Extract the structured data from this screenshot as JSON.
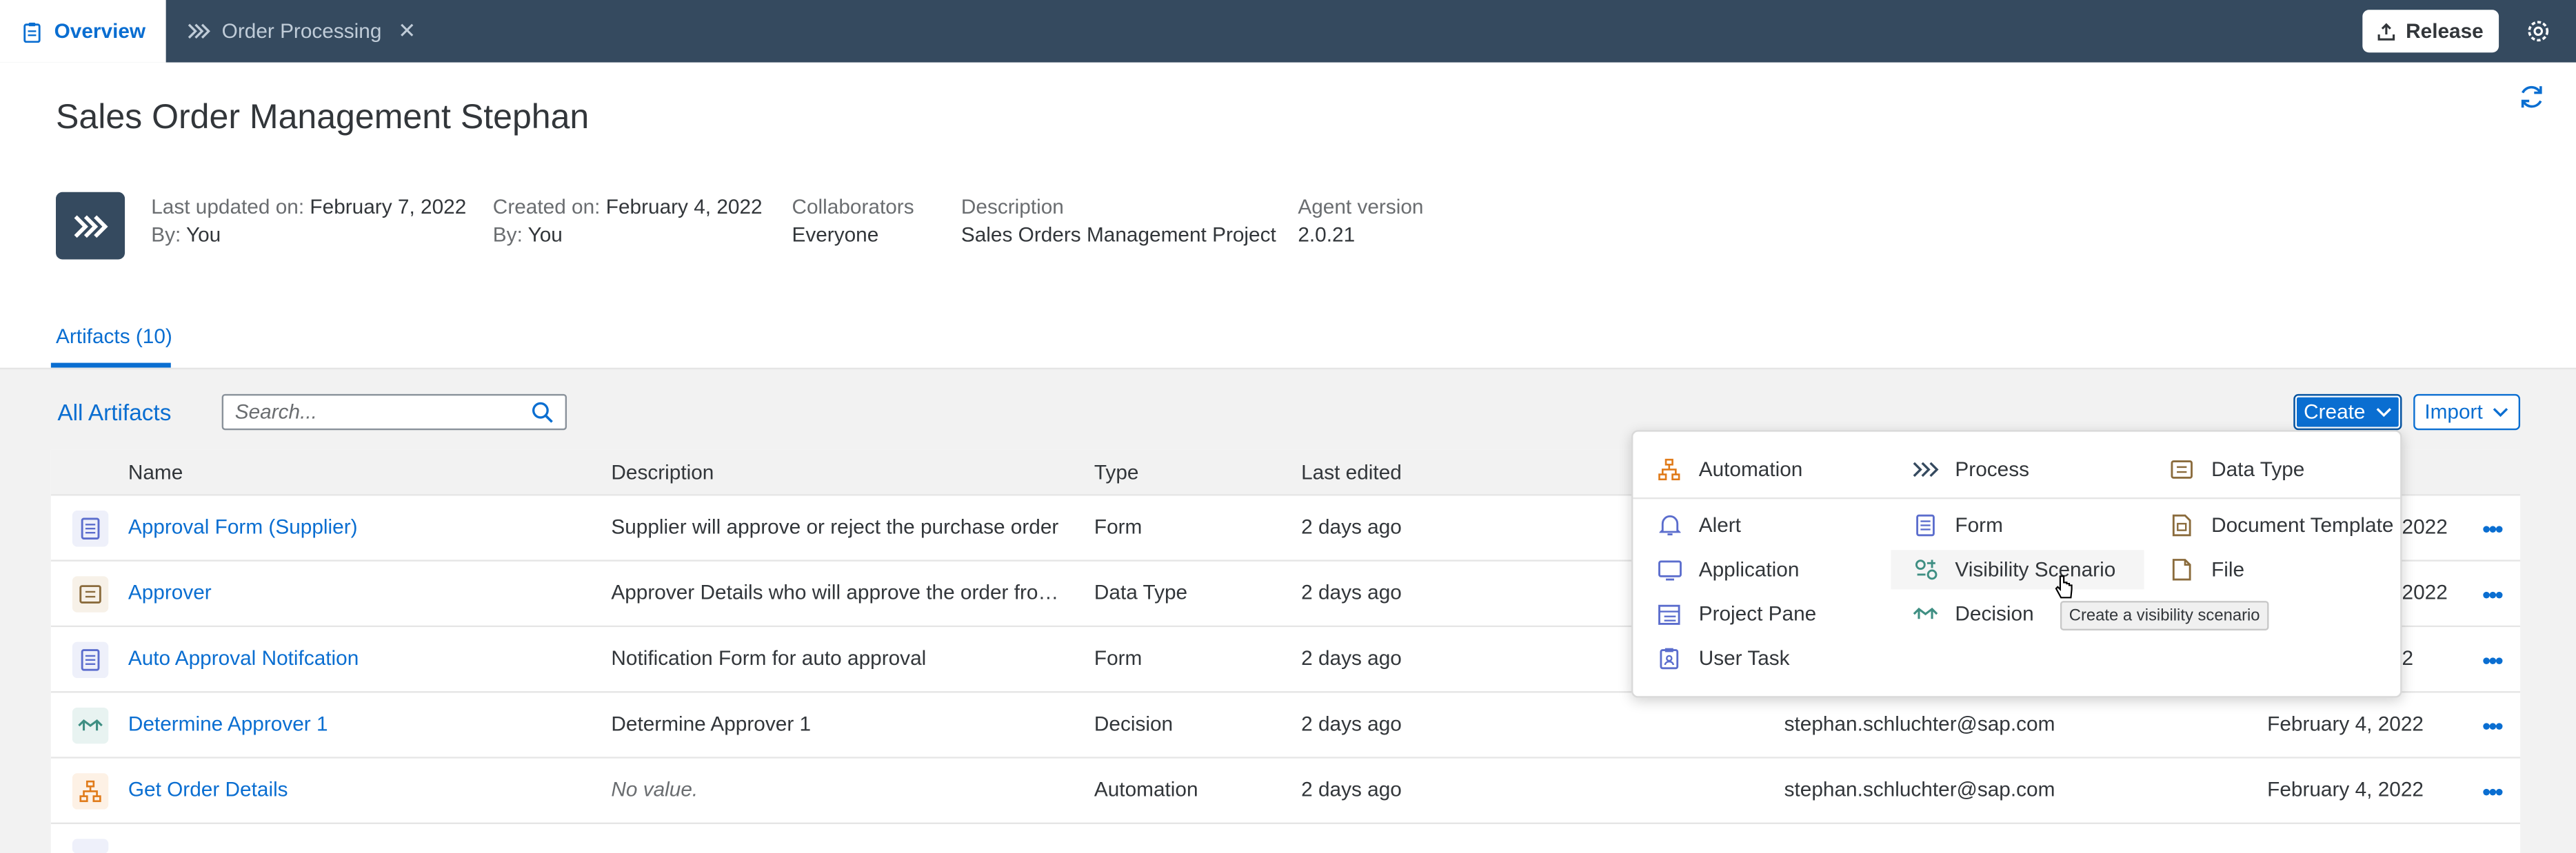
{
  "tabs": [
    {
      "label": "Overview",
      "icon": "clipboard-icon"
    },
    {
      "label": "Order Processing",
      "icon": "process-chevrons-icon"
    }
  ],
  "toolbar": {
    "release_label": "Release"
  },
  "header": {
    "title": "Sales Order Management Stephan",
    "last_updated_label": "Last updated on:",
    "last_updated_value": "February 7, 2022",
    "last_by_label": "By:",
    "last_by_value": "You",
    "created_label": "Created on:",
    "created_value": "February 4, 2022",
    "created_by_label": "By:",
    "created_by_value": "You",
    "collaborators_label": "Collaborators",
    "collaborators_value": "Everyone",
    "description_label": "Description",
    "description_value": "Sales Orders Management Project",
    "agent_label": "Agent version",
    "agent_value": "2.0.21"
  },
  "artifacts_tab": "Artifacts (10)",
  "artifacts": {
    "heading": "All Artifacts",
    "search_placeholder": "Search...",
    "create_label": "Create",
    "import_label": "Import",
    "columns": [
      "Name",
      "Description",
      "Type",
      "Last edited"
    ],
    "rows": [
      {
        "name": "Approval Form (Supplier)",
        "description": "Supplier will approve or reject the purchase order",
        "type": "Form",
        "last_edited": "2 days ago",
        "edited_by": "",
        "created": "2022",
        "icon": "form-icon"
      },
      {
        "name": "Approver",
        "description": "Approver Details who will approve the order from su...",
        "type": "Data Type",
        "last_edited": "2 days ago",
        "edited_by": "",
        "created": "2022",
        "icon": "data-type-icon"
      },
      {
        "name": "Auto Approval Notifcation",
        "description": "Notification Form for auto approval",
        "type": "Form",
        "last_edited": "2 days ago",
        "edited_by": "",
        "created": "2",
        "icon": "form-icon"
      },
      {
        "name": "Determine Approver 1",
        "description": "Determine Approver 1",
        "type": "Decision",
        "last_edited": "2 days ago",
        "edited_by": "stephan.schluchter@sap.com",
        "created": "February 4, 2022",
        "icon": "decision-icon"
      },
      {
        "name": "Get Order Details",
        "description": "No value.",
        "type": "Automation",
        "last_edited": "2 days ago",
        "edited_by": "stephan.schluchter@sap.com",
        "created": "February 4, 2022",
        "icon": "automation-icon"
      }
    ]
  },
  "create_menu": {
    "top": [
      {
        "label": "Automation",
        "icon": "automation-icon"
      },
      {
        "label": "Process",
        "icon": "process-chevrons-icon"
      },
      {
        "label": "Data Type",
        "icon": "data-type-icon"
      }
    ],
    "col1": [
      {
        "label": "Alert",
        "icon": "bell-icon"
      },
      {
        "label": "Application",
        "icon": "monitor-icon"
      },
      {
        "label": "Project Pane",
        "icon": "project-pane-icon"
      },
      {
        "label": "User Task",
        "icon": "user-task-icon"
      }
    ],
    "col2": [
      {
        "label": "Form",
        "icon": "form-icon"
      },
      {
        "label": "Visibility Scenario",
        "icon": "visibility-scenario-icon"
      },
      {
        "label": "Decision",
        "icon": "decision-icon"
      }
    ],
    "col3": [
      {
        "label": "Document Template",
        "icon": "document-template-icon"
      },
      {
        "label": "File",
        "icon": "file-icon"
      }
    ],
    "tooltip": "Create a visibility scenario"
  },
  "colors": {
    "topbar": "#354a5f",
    "accent": "#0a6ed1",
    "automation": "#e07b1a",
    "form": "#5b6dcd",
    "datatype": "#8a6b3c",
    "decision": "#3f8f83"
  }
}
